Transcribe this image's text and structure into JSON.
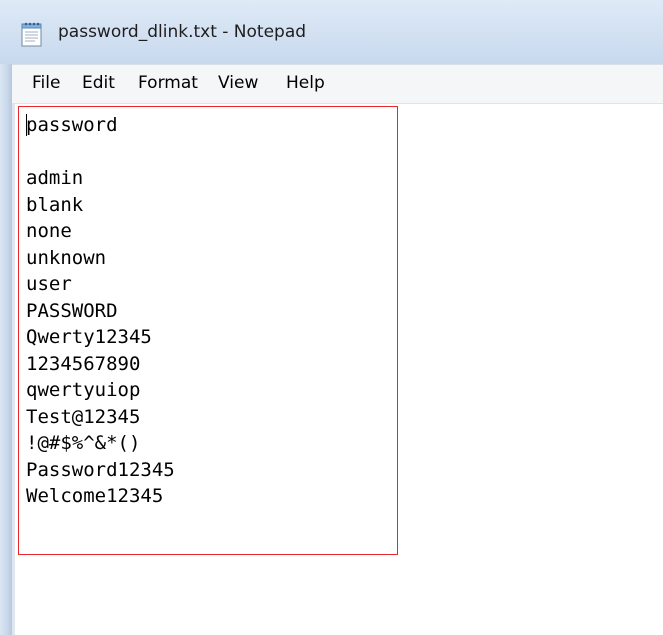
{
  "window": {
    "title": "password_dlink.txt - Notepad",
    "icon": "notepad-icon"
  },
  "menu": {
    "items": [
      {
        "label": "File"
      },
      {
        "label": "Edit"
      },
      {
        "label": "Format"
      },
      {
        "label": "View"
      },
      {
        "label": "Help"
      }
    ]
  },
  "document": {
    "lines": [
      "password",
      "",
      "admin",
      "blank",
      "none",
      "unknown",
      "user",
      "PASSWORD",
      "Qwerty12345",
      "1234567890",
      "qwertyuiop",
      "Test@12345",
      "!@#$%^&*()",
      "Password12345",
      "Welcome12345"
    ]
  },
  "annotation": {
    "color": "#e8262c"
  }
}
